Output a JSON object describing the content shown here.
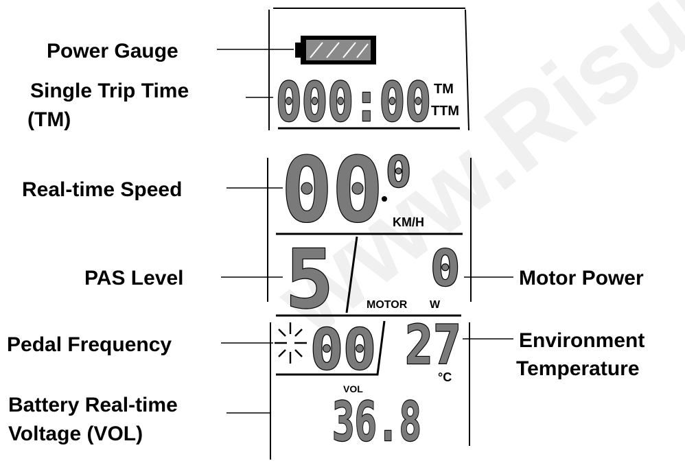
{
  "labels": {
    "power_gauge": "Power Gauge",
    "single_trip_time_1": "Single Trip Time",
    "single_trip_time_2": "(TM)",
    "real_time_speed": "Real-time Speed",
    "pas_level": "PAS Level",
    "motor_power": "Motor Power",
    "pedal_frequency": "Pedal Frequency",
    "environment_temperature_1": "Environment",
    "environment_temperature_2": "Temperature",
    "battery_voltage_1": "Battery Real-time",
    "battery_voltage_2": "Voltage (VOL)"
  },
  "display": {
    "trip_time": "000:00",
    "tm_unit": "TM",
    "ttm_unit": "TTM",
    "speed_main": "00",
    "speed_decimal": "0",
    "speed_unit": "KM/H",
    "pas_level": "5",
    "motor_power": "0",
    "motor_label": "MOTOR",
    "motor_unit": "W",
    "pedal_frequency": "00",
    "temperature": "27",
    "temperature_unit": "°C",
    "vol_label": "VOL",
    "voltage": "36.8"
  },
  "watermark": "www.Risun"
}
